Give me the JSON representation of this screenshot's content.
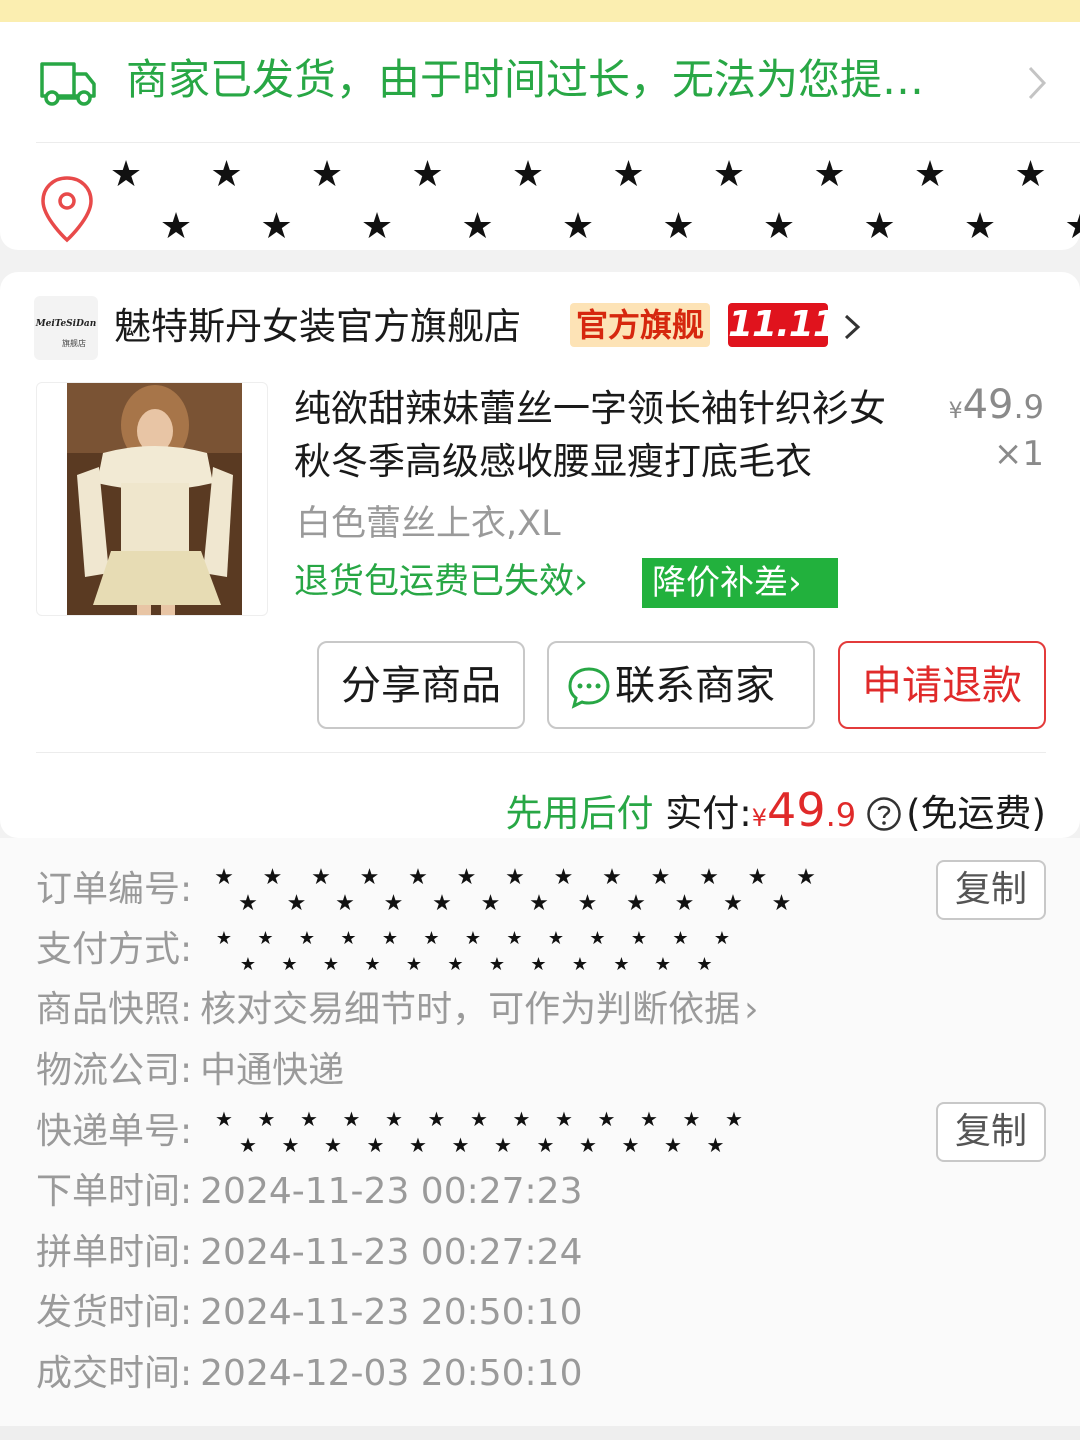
{
  "logistics": {
    "status_text": "商家已发货，由于时间过长，无法为您提供物流信息",
    "address_masked": "★★★★★★★★★★★★★★★★★★★★"
  },
  "store": {
    "logo_text_top": "MeiTeSiDan",
    "logo_text_bottom": "旗舰店",
    "name": "魅特斯丹女装官方旗舰店",
    "official_badge": "官方旗舰",
    "promo_badge": "11.11"
  },
  "product": {
    "title": "纯欲甜辣妹蕾丝一字领长袖针织衫女秋冬季高级感收腰显瘦打底毛衣",
    "price_currency": "¥",
    "price_int": "49",
    "price_dec": ".9",
    "quantity": "×1",
    "sku": "白色蕾丝上衣,XL",
    "return_shipping": "退货包运费已失效",
    "price_protect": "降价补差"
  },
  "actions": {
    "share": "分享商品",
    "contact": "联系商家",
    "refund": "申请退款"
  },
  "payment": {
    "pay_later": "先用后付",
    "paid_label": "实付:",
    "currency": "¥",
    "amount_int": "49",
    "amount_dec": ".9",
    "shipping_note": "(免运费)"
  },
  "details": {
    "order_no_label": "订单编号:",
    "pay_method_label": "支付方式:",
    "snapshot_label": "商品快照:",
    "snapshot_value": "核对交易细节时，可作为判断依据",
    "courier_label": "物流公司:",
    "courier_value": "中通快递",
    "tracking_label": "快递单号:",
    "order_time_label": "下单时间:",
    "order_time": "2024-11-23 00:27:23",
    "group_time_label": "拼单时间:",
    "group_time": "2024-11-23 00:27:24",
    "ship_time_label": "发货时间:",
    "ship_time": "2024-11-23 20:50:10",
    "deal_time_label": "成交时间:",
    "deal_time": "2024-12-03 20:50:10",
    "copy_label": "复制"
  },
  "colors": {
    "green": "#28a745",
    "red": "#e02a2a",
    "badge_red": "#e0131d",
    "badge_gold": "#fde3b6"
  }
}
